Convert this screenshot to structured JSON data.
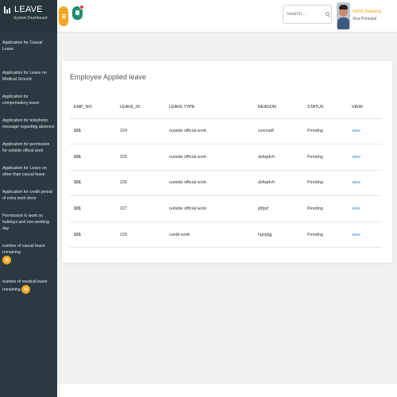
{
  "brand": {
    "title": "LEAVE",
    "subtitle": "System Dashboard"
  },
  "sidebar": {
    "items": [
      {
        "label": "Application for Casual Leave"
      },
      {
        "label": "Application for Leave on Medical Ground"
      },
      {
        "label": "Application for compensatory leave"
      },
      {
        "label": "Application for telephonic message regarding absence"
      },
      {
        "label": "Application for permission for outside offical work"
      },
      {
        "label": "Application for Leave on other than casual leave"
      },
      {
        "label": "Application for credit period of extra work done"
      },
      {
        "label": "Permission to work on holidays and non-working day"
      },
      {
        "label": "number of casual leave remaining",
        "badge": "10"
      },
      {
        "label": "number of medical leave remaining",
        "badge": "10"
      }
    ]
  },
  "header": {
    "search": {
      "placeholder": "Search..."
    },
    "user": {
      "name": "nikhil jhakaria",
      "role": "Vice Principal"
    }
  },
  "main": {
    "title": "Employee Applied leave",
    "columns": [
      "EMP_NO",
      "LEAVE_ID",
      "LEAVE TYPE",
      "REASON",
      "STATUS",
      "VIEW"
    ],
    "rows": [
      {
        "emp_no": "101",
        "leave_id": "224",
        "leave_type": "outside official work",
        "reason": "xvzmsdf",
        "status": "Pending",
        "view": "view"
      },
      {
        "emp_no": "101",
        "leave_id": "225",
        "leave_type": "outside official work",
        "reason": "dsfwjdvh",
        "status": "Pending",
        "view": "view"
      },
      {
        "emp_no": "101",
        "leave_id": "226",
        "leave_type": "outside official work",
        "reason": "dsfwjdvh",
        "status": "Pending",
        "view": "view"
      },
      {
        "emp_no": "101",
        "leave_id": "227",
        "leave_type": "outside official work",
        "reason": "jdfgsf",
        "status": "Pending",
        "view": "view"
      },
      {
        "emp_no": "101",
        "leave_id": "229",
        "leave_type": "credit work",
        "reason": "hgnjdgj",
        "status": "Pending",
        "view": "view"
      }
    ]
  },
  "icons": {
    "menu": "hamburger-icon",
    "notifications": "notification-icon",
    "search": "search-icon",
    "brand": "bar-chart-icon"
  },
  "colors": {
    "sidebar_bg": "#2b3a42",
    "accent": "#f5a623",
    "notification": "#1f8c6f",
    "link": "#3a86c8"
  }
}
